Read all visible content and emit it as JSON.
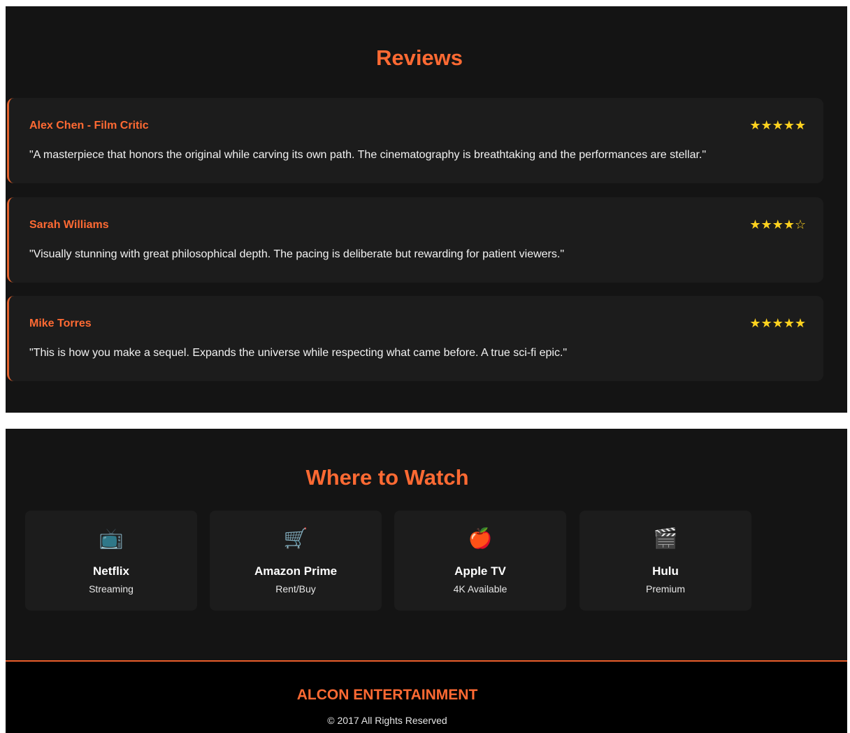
{
  "reviews": {
    "title": "Reviews",
    "items": [
      {
        "author": "Alex Chen - Film Critic",
        "stars": "★★★★★",
        "rating": 5,
        "text": "\"A masterpiece that honors the original while carving its own path. The cinematography is breathtaking and the performances are stellar.\""
      },
      {
        "author": "Sarah Williams",
        "stars": "★★★★☆",
        "rating": 4,
        "text": "\"Visually stunning with great philosophical depth. The pacing is deliberate but rewarding for patient viewers.\""
      },
      {
        "author": "Mike Torres",
        "stars": "★★★★★",
        "rating": 5,
        "text": "\"This is how you make a sequel. Expands the universe while respecting what came before. A true sci-fi epic.\""
      }
    ]
  },
  "watch": {
    "title": "Where to Watch",
    "platforms": [
      {
        "icon": "📺",
        "icon_name": "television-icon",
        "name": "Netflix",
        "type": "Streaming"
      },
      {
        "icon": "🛒",
        "icon_name": "shopping-cart-icon",
        "name": "Amazon Prime",
        "type": "Rent/Buy"
      },
      {
        "icon": "🍎",
        "icon_name": "apple-icon",
        "name": "Apple TV",
        "type": "4K Available"
      },
      {
        "icon": "🎬",
        "icon_name": "clapperboard-icon",
        "name": "Hulu",
        "type": "Premium"
      }
    ]
  },
  "footer": {
    "brand": "ALCON ENTERTAINMENT",
    "copyright": "© 2017 All Rights Reserved"
  },
  "colors": {
    "accent": "#ff6a33",
    "star": "#ffd21f",
    "background": "#141414",
    "card": "#1c1c1c"
  }
}
